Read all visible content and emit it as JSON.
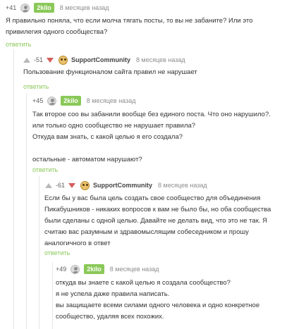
{
  "comments": [
    {
      "rating": "+41",
      "vote_state": "none",
      "author": "2kilo",
      "author_style": "badge",
      "avatar_icon": "user-avatar-icon",
      "time": "8 месяцев назад",
      "lines": [
        "Я правильно поняла, что если молча тягать посты, то вы не забаните? Или это",
        "привилегия одного сообщества?"
      ],
      "reply_label": "ответить"
    },
    {
      "rating": "-51",
      "vote_state": "down",
      "author": "SupportCommunity",
      "author_style": "plain",
      "avatar_icon": "community-avatar-icon",
      "time": "8 месяцев назад",
      "lines": [
        "Пользование функционалом сайта правил не нарушает"
      ],
      "reply_label": "ответить"
    },
    {
      "rating": "+45",
      "vote_state": "none",
      "author": "2kilo",
      "author_style": "badge",
      "avatar_icon": "user-avatar-icon",
      "time": "8 месяцев назад",
      "lines": [
        "Так второе соо вы забанили вообще без единого поста. Что оно нарушило?.",
        "или только одно сообщество не нарушает правила?",
        "Откуда вам знать, с какой целью я его создала?",
        "",
        "остальные - автоматом нарушают?"
      ],
      "reply_label": "ответить"
    },
    {
      "rating": "-61",
      "vote_state": "down",
      "author": "SupportCommunity",
      "author_style": "plain",
      "avatar_icon": "community-avatar-icon",
      "time": "8 месяцев назад",
      "lines": [
        "Если бы у вас была цель создать свое сообщество для объединения",
        "Пикабушников - никаких вопросов к вам не было бы, но оба сообщества",
        "были сделаны с одной целью. Давайте не делать вид, что это не так. Я",
        "считаю вас разумным и здравомыслящим собеседником и прошу",
        "аналогичного в ответ"
      ],
      "reply_label": "ответить"
    },
    {
      "rating": "+49",
      "vote_state": "none",
      "author": "2kilo",
      "author_style": "badge",
      "avatar_icon": "user-avatar-icon",
      "time": "8 месяцев назад",
      "lines": [
        "откуда вы знаете с какой целью я создала сообщество?",
        "я не успела даже правила написать.",
        "вы защищаете всеми силами одного человека и одно конкретное",
        "сообщество, удаляя всех похожих."
      ],
      "reply_label": ""
    }
  ],
  "colors": {
    "accent_green": "#8ac858",
    "vote_gray": "#b9b9b9",
    "thread_line": "#e5e5e5",
    "time_gray": "#8d8d8d"
  }
}
